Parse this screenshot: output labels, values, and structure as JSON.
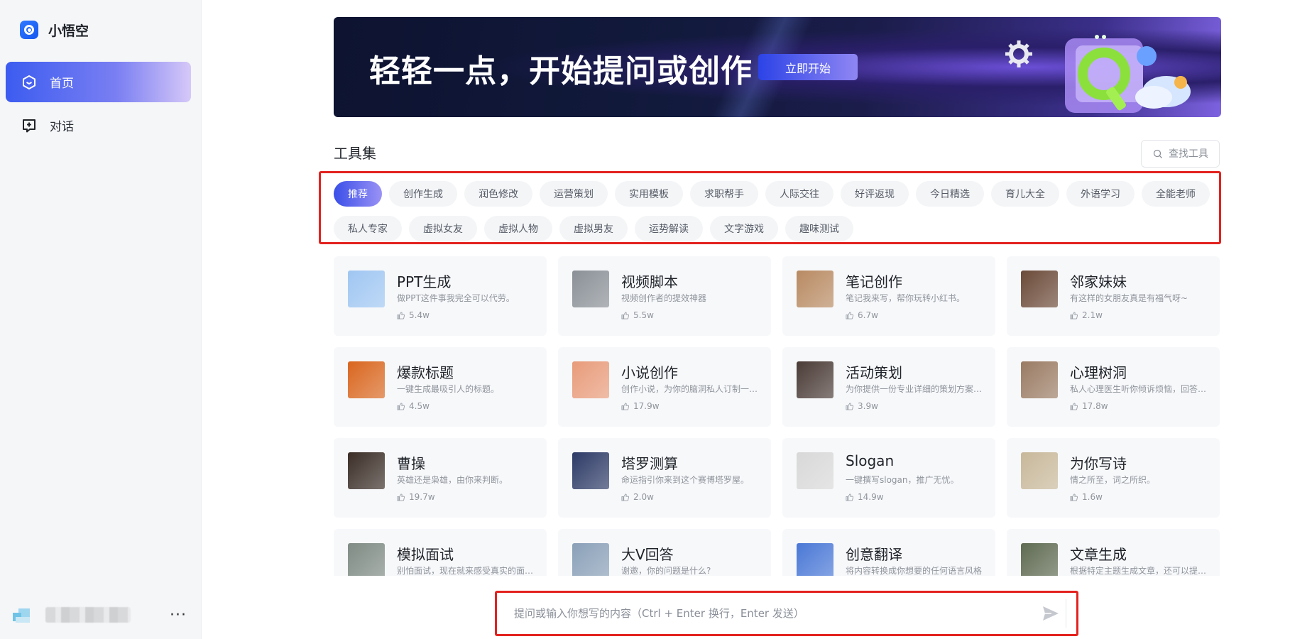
{
  "sidebar": {
    "brand_name": "小悟空",
    "nav": [
      {
        "label": "首页",
        "active": true
      },
      {
        "label": "对话",
        "active": false
      }
    ],
    "more_label": "···"
  },
  "banner": {
    "title": "轻轻一点，开始提问或创作",
    "button_label": "立即开始"
  },
  "tools": {
    "section_title": "工具集",
    "search_placeholder": "查找工具",
    "tags_row1": [
      "推荐",
      "创作生成",
      "润色修改",
      "运营策划",
      "实用模板",
      "求职帮手",
      "人际交往",
      "好评返现",
      "今日精选",
      "育儿大全",
      "外语学习",
      "全能老师"
    ],
    "tags_row2": [
      "私人专家",
      "虚拟女友",
      "虚拟人物",
      "虚拟男友",
      "运势解读",
      "文字游戏",
      "趣味测试"
    ]
  },
  "cards": [
    {
      "title": "PPT生成",
      "desc": "做PPT这件事我完全可以代劳。",
      "count": "5.4w",
      "thumb_color": "#9fc6f2"
    },
    {
      "title": "视频脚本",
      "desc": "视频创作者的提效神器",
      "count": "5.5w",
      "thumb_color": "#8a9097"
    },
    {
      "title": "笔记创作",
      "desc": "笔记我来写，帮你玩转小红书。",
      "count": "6.7w",
      "thumb_color": "#b88a62"
    },
    {
      "title": "邻家妹妹",
      "desc": "有这样的女朋友真是有福气呀~",
      "count": "2.1w",
      "thumb_color": "#6b4a38"
    },
    {
      "title": "爆款标题",
      "desc": "一键生成最吸引人的标题。",
      "count": "4.5w",
      "thumb_color": "#d9661f"
    },
    {
      "title": "小说创作",
      "desc": "创作小说，为你的脑洞私人订制一段精彩故事",
      "count": "17.9w",
      "thumb_color": "#e89b7a"
    },
    {
      "title": "活动策划",
      "desc": "为你提供一份专业详细的策划方案，帮助你轻松策划",
      "count": "3.9w",
      "thumb_color": "#4a3b36"
    },
    {
      "title": "心理树洞",
      "desc": "私人心理医生听你倾诉烦恼，回答你的问题",
      "count": "17.8w",
      "thumb_color": "#9a7b63"
    },
    {
      "title": "曹操",
      "desc": "英雄还是枭雄，由你来判断。",
      "count": "19.7w",
      "thumb_color": "#3a2d26"
    },
    {
      "title": "塔罗测算",
      "desc": "命运指引你来到这个赛博塔罗屋。",
      "count": "2.0w",
      "thumb_color": "#2d3a66"
    },
    {
      "title": "Slogan",
      "desc": "一键撰写slogan，推广无忧。",
      "count": "14.9w",
      "thumb_color": "#d8d8d8"
    },
    {
      "title": "为你写诗",
      "desc": "情之所至，词之所织。",
      "count": "1.6w",
      "thumb_color": "#c8b89a"
    },
    {
      "title": "模拟面试",
      "desc": "别怕面试，现在就来感受真实的面试场景",
      "count": "",
      "thumb_color": "#7f8b84"
    },
    {
      "title": "大V回答",
      "desc": "谢邀，你的问题是什么?",
      "count": "",
      "thumb_color": "#8aa0b8"
    },
    {
      "title": "创意翻译",
      "desc": "将内容转换成你想要的任何语言风格",
      "count": "",
      "thumb_color": "#4a78d6"
    },
    {
      "title": "文章生成",
      "desc": "根据特定主题生成文章，还可以提供大纲",
      "count": "",
      "thumb_color": "#5f6b52"
    }
  ],
  "chat": {
    "placeholder": "提问或输入你想写的内容（Ctrl + Enter 换行，Enter 发送）"
  },
  "colors": {
    "accent": "#3c5cf0",
    "highlight_border": "#e3221e",
    "card_bg": "#f7f8fa"
  }
}
